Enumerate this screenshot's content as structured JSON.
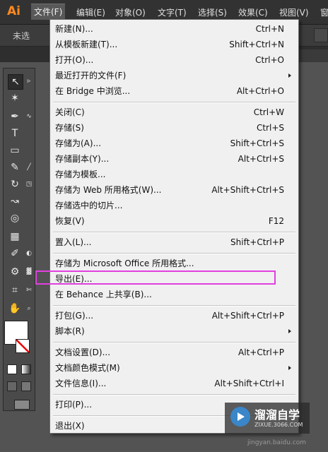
{
  "app": {
    "logo": "Ai"
  },
  "menubar": {
    "items": [
      "文件(F)",
      "编辑(E)",
      "对象(O)",
      "文字(T)",
      "选择(S)",
      "效果(C)",
      "视图(V)",
      "窗"
    ]
  },
  "controlbar": {
    "selection_label": "未选"
  },
  "file_menu": {
    "items": [
      {
        "label": "新建(N)...",
        "shortcut": "Ctrl+N"
      },
      {
        "label": "从模板新建(T)...",
        "shortcut": "Shift+Ctrl+N"
      },
      {
        "label": "打开(O)...",
        "shortcut": "Ctrl+O"
      },
      {
        "label": "最近打开的文件(F)",
        "shortcut": ""
      },
      {
        "label": "在 Bridge 中浏览...",
        "shortcut": "Alt+Ctrl+O"
      },
      {
        "label": "关闭(C)",
        "shortcut": "Ctrl+W"
      },
      {
        "label": "存储(S)",
        "shortcut": "Ctrl+S"
      },
      {
        "label": "存储为(A)...",
        "shortcut": "Shift+Ctrl+S"
      },
      {
        "label": "存储副本(Y)...",
        "shortcut": "Alt+Ctrl+S"
      },
      {
        "label": "存储为模板...",
        "shortcut": ""
      },
      {
        "label": "存储为 Web 所用格式(W)...",
        "shortcut": "Alt+Shift+Ctrl+S"
      },
      {
        "label": "存储选中的切片...",
        "shortcut": ""
      },
      {
        "label": "恢复(V)",
        "shortcut": "F12"
      },
      {
        "label": "置入(L)...",
        "shortcut": "Shift+Ctrl+P"
      },
      {
        "label": "存储为 Microsoft Office 所用格式...",
        "shortcut": ""
      },
      {
        "label": "导出(E)...",
        "shortcut": ""
      },
      {
        "label": "在 Behance 上共享(B)...",
        "shortcut": ""
      },
      {
        "label": "打包(G)...",
        "shortcut": "Alt+Shift+Ctrl+P"
      },
      {
        "label": "脚本(R)",
        "shortcut": ""
      },
      {
        "label": "文档设置(D)...",
        "shortcut": "Alt+Ctrl+P"
      },
      {
        "label": "文档颜色模式(M)",
        "shortcut": ""
      },
      {
        "label": "文件信息(I)...",
        "shortcut": "Alt+Shift+Ctrl+I"
      },
      {
        "label": "打印(P)...",
        "shortcut": ""
      },
      {
        "label": "退出(X)",
        "shortcut": ""
      }
    ]
  },
  "watermark": {
    "brand": "溜溜自学",
    "url": "ZIXUE.3066.COM",
    "site": "jingyan.baidu.com"
  },
  "colors": {
    "highlight": "#e040e0",
    "logo": "#ff8a1f"
  }
}
